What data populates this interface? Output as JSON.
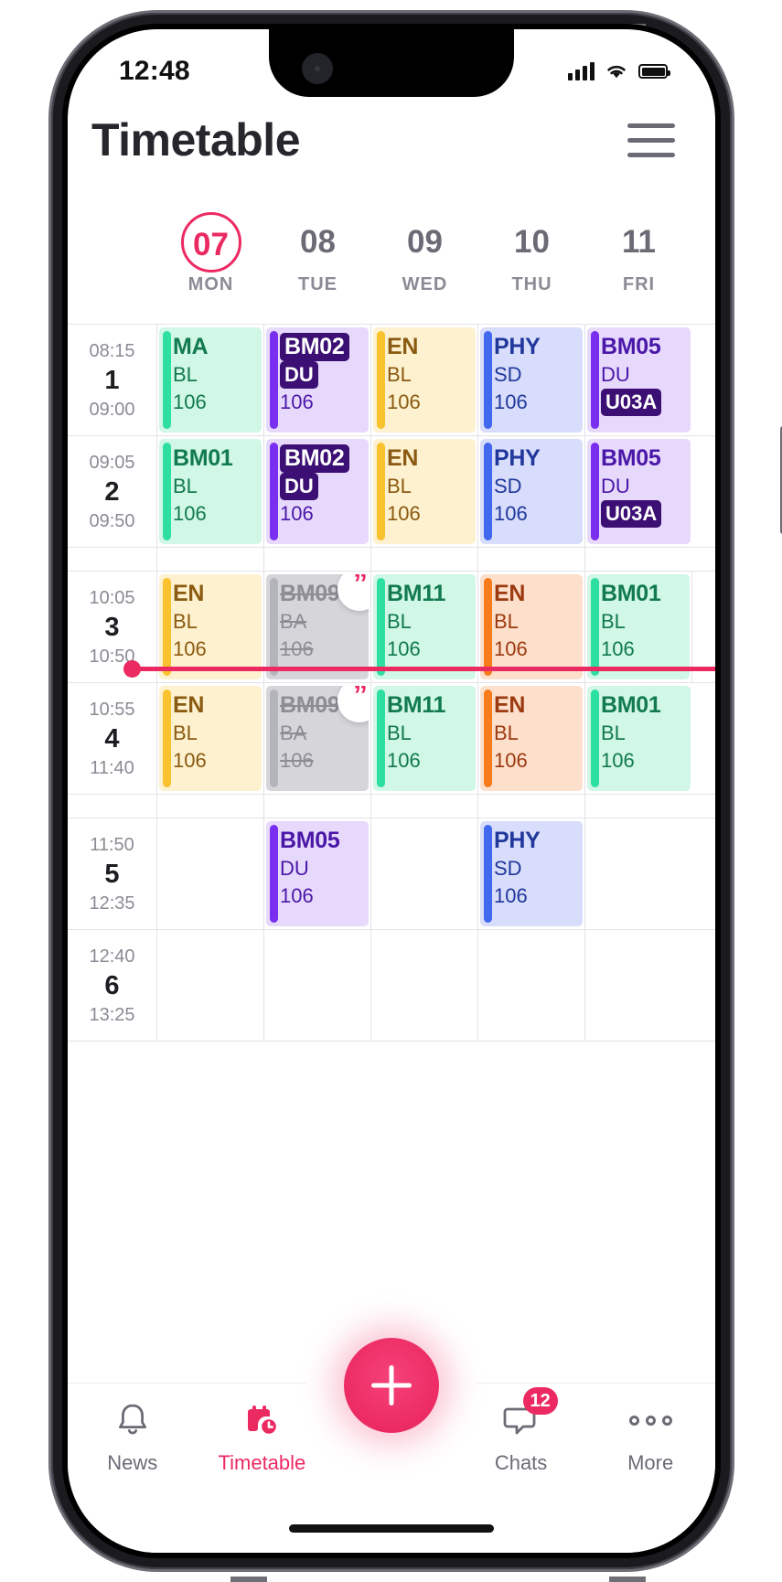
{
  "status_bar": {
    "time": "12:48",
    "signal_icon": "cellular-signal-icon",
    "wifi_icon": "wifi-icon",
    "battery_icon": "battery-icon"
  },
  "header": {
    "title": "Timetable",
    "menu_icon": "hamburger-menu-icon"
  },
  "days": [
    {
      "num": "07",
      "dow": "MON",
      "today": true
    },
    {
      "num": "08",
      "dow": "TUE",
      "today": false
    },
    {
      "num": "09",
      "dow": "WED",
      "today": false
    },
    {
      "num": "10",
      "dow": "THU",
      "today": false
    },
    {
      "num": "11",
      "dow": "FRI",
      "today": false
    }
  ],
  "periods": [
    {
      "number": "1",
      "start": "08:15",
      "end": "09:00"
    },
    {
      "number": "2",
      "start": "09:05",
      "end": "09:50"
    },
    {
      "number": "3",
      "start": "10:05",
      "end": "10:50"
    },
    {
      "number": "4",
      "start": "10:55",
      "end": "11:40"
    },
    {
      "number": "5",
      "start": "11:50",
      "end": "12:35"
    },
    {
      "number": "6",
      "start": "12:40",
      "end": "13:25"
    }
  ],
  "lessons": {
    "p1": [
      {
        "subject": "MA",
        "teacher": "BL",
        "room": "106",
        "theme": "mint"
      },
      {
        "subject": "BM02",
        "teacher": "DU",
        "room": "106",
        "theme": "violet",
        "subject_badge": true,
        "teacher_badge": true
      },
      {
        "subject": "EN",
        "teacher": "BL",
        "room": "106",
        "theme": "yellow"
      },
      {
        "subject": "PHY",
        "teacher": "SD",
        "room": "106",
        "theme": "blue"
      },
      {
        "subject": "BM05",
        "teacher": "DU",
        "room": "U03A",
        "theme": "violet",
        "room_badge": true
      }
    ],
    "p2": [
      {
        "subject": "BM01",
        "teacher": "BL",
        "room": "106",
        "theme": "mint"
      },
      {
        "subject": "BM02",
        "teacher": "DU",
        "room": "106",
        "theme": "violet",
        "subject_badge": true,
        "teacher_badge": true
      },
      {
        "subject": "EN",
        "teacher": "BL",
        "room": "106",
        "theme": "yellow"
      },
      {
        "subject": "PHY",
        "teacher": "SD",
        "room": "106",
        "theme": "blue"
      },
      {
        "subject": "BM05",
        "teacher": "DU",
        "room": "U03A",
        "theme": "violet",
        "room_badge": true
      }
    ],
    "p3": [
      {
        "subject": "EN",
        "teacher": "BL",
        "room": "106",
        "theme": "yellow"
      },
      {
        "subject": "BM09",
        "teacher": "BA",
        "room": "106",
        "theme": "grey",
        "cancelled": true,
        "note": true
      },
      {
        "subject": "BM11",
        "teacher": "BL",
        "room": "106",
        "theme": "mint"
      },
      {
        "subject": "EN",
        "teacher": "BL",
        "room": "106",
        "theme": "peach"
      },
      {
        "subject": "BM01",
        "teacher": "BL",
        "room": "106",
        "theme": "mint"
      }
    ],
    "p4": [
      {
        "subject": "EN",
        "teacher": "BL",
        "room": "106",
        "theme": "yellow"
      },
      {
        "subject": "BM09",
        "teacher": "BA",
        "room": "106",
        "theme": "grey",
        "cancelled": true,
        "note": true
      },
      {
        "subject": "BM11",
        "teacher": "BL",
        "room": "106",
        "theme": "mint"
      },
      {
        "subject": "EN",
        "teacher": "BL",
        "room": "106",
        "theme": "peach"
      },
      {
        "subject": "BM01",
        "teacher": "BL",
        "room": "106",
        "theme": "mint"
      }
    ],
    "p5": [
      null,
      {
        "subject": "BM05",
        "teacher": "DU",
        "room": "106",
        "theme": "violet"
      },
      null,
      {
        "subject": "PHY",
        "teacher": "SD",
        "room": "106",
        "theme": "blue"
      },
      null
    ],
    "p6": [
      null,
      null,
      null,
      null,
      null
    ]
  },
  "colors": {
    "accent": "#ec2a62",
    "mint_bg": "#d1f7e6",
    "mint_bar": "#2ee0a0",
    "mint_text": "#117a4e",
    "violet_bg": "#e7d9fb",
    "violet_bar": "#7a2ef0",
    "violet_text": "#4a17a8",
    "yellow_bg": "#fdf1cf",
    "yellow_bar": "#f9c22e",
    "yellow_text": "#8a5a10",
    "blue_bg": "#d7ddfa",
    "blue_bar": "#4268ef",
    "blue_text": "#21379c",
    "peach_bg": "#fde0cc",
    "peach_bar": "#f97c1c",
    "peach_text": "#9c3a10",
    "grey_bg": "#d6d6da",
    "grey_bar": "#b4b4bc",
    "grey_text": "#8d8d96",
    "badge_dark": "#3b0f73"
  },
  "tabbar": {
    "items": [
      {
        "label": "News",
        "icon": "bell-icon",
        "active": false
      },
      {
        "label": "Timetable",
        "icon": "calendar-clock-icon",
        "active": true
      },
      {
        "label": "Chats",
        "icon": "chat-bubble-icon",
        "active": false,
        "badge": "12"
      },
      {
        "label": "More",
        "icon": "ellipsis-icon",
        "active": false
      }
    ],
    "fab": {
      "icon": "plus-icon",
      "label": ""
    }
  }
}
